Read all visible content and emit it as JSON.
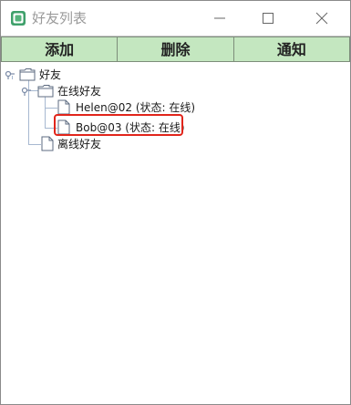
{
  "window": {
    "title": "好友列表"
  },
  "toolbar": {
    "buttons": [
      "添加",
      "删除",
      "通知"
    ]
  },
  "tree": {
    "root_label": "好友",
    "online_group_label": "在线好友",
    "online_friends": [
      "Helen@02 (状态: 在线)",
      "Bob@03 (状态: 在线)"
    ],
    "offline_group_label": "离线好友"
  },
  "colors": {
    "toolbar_button_bg": "#c4e7c0",
    "highlight_border": "#e1251b",
    "tree_line": "#a7b8d0"
  }
}
